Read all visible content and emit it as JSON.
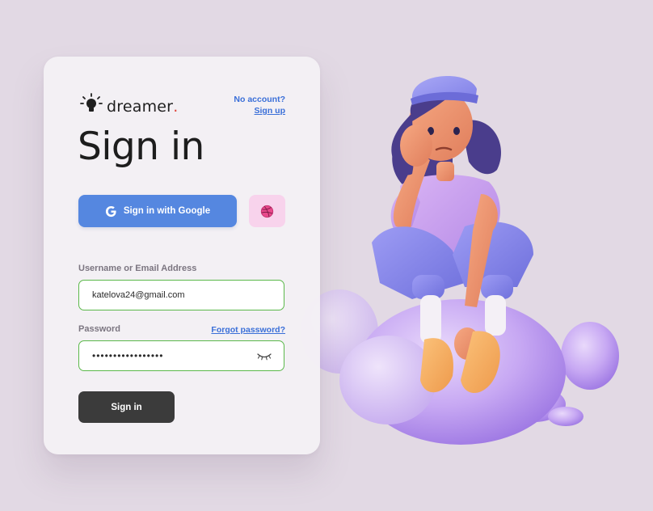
{
  "brand": {
    "name": "dreamer",
    "dot": ".",
    "accent_color": "#e0443a",
    "icon": "lightbulb-icon"
  },
  "header": {
    "no_account_text": "No account?",
    "signup_link": "Sign up"
  },
  "title": "Sign in",
  "social": {
    "google_label": "Sign in with Google",
    "google_icon": "google-icon",
    "google_color": "#5587e0",
    "dribbble_icon": "dribbble-icon",
    "dribbble_bg": "#f8d3ec"
  },
  "form": {
    "username_label": "Username or Email Address",
    "username_value": "katelova24@gmail.com",
    "password_label": "Password",
    "password_value": "•••••••••••••••••",
    "forgot_link": "Forgot password?",
    "eye_icon": "eye-closed-icon",
    "valid_border_color": "#5bb84a",
    "submit_label": "Sign in"
  },
  "colors": {
    "background": "#e2d9e4",
    "card": "#f4f0f5",
    "link": "#3a6fd8",
    "submit_bg": "#3b3b3b"
  }
}
